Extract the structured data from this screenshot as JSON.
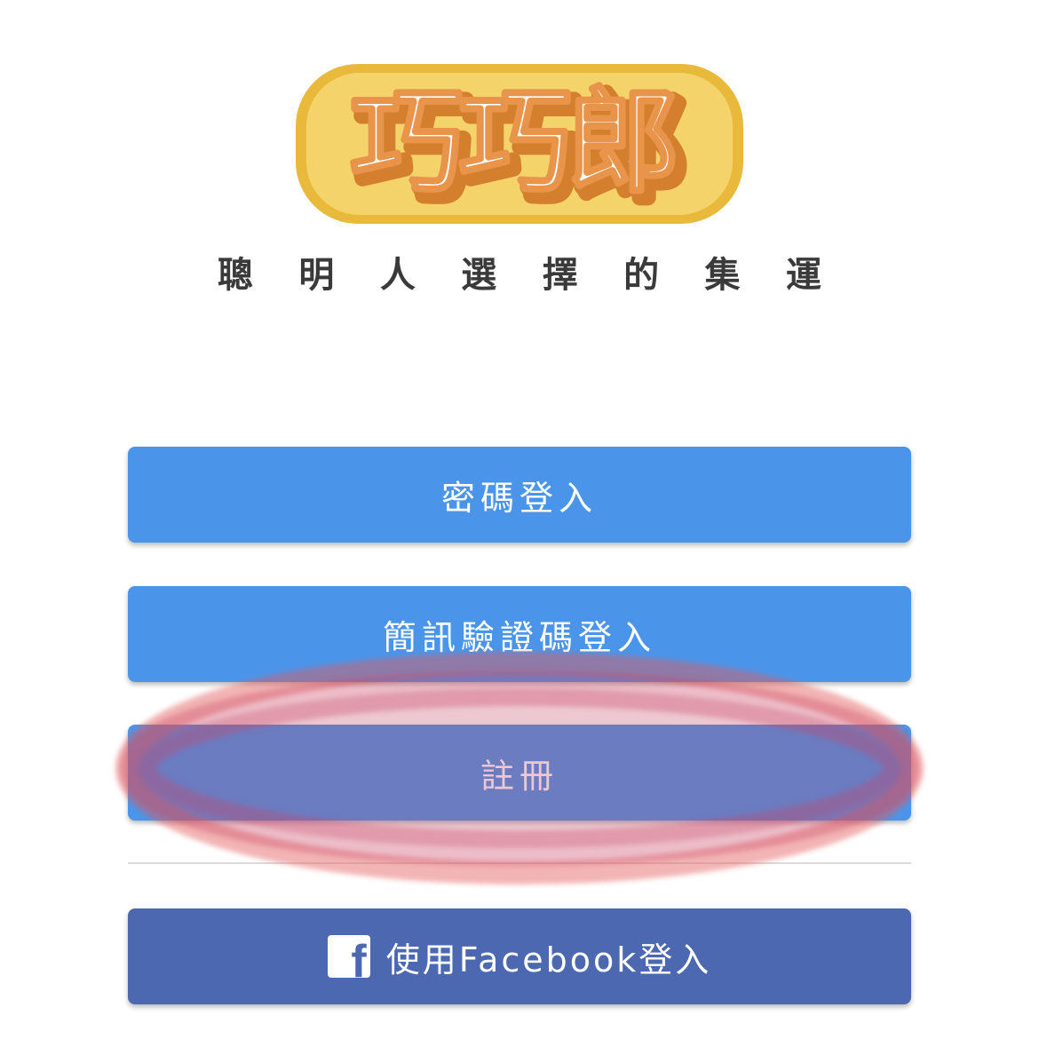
{
  "logo": {
    "text": "巧巧郎",
    "slogan": [
      "聰",
      "明",
      "人",
      "選",
      "擇",
      "的",
      "集",
      "運"
    ]
  },
  "buttons": {
    "password_login": "密碼登入",
    "sms_login": "簡訊驗證碼登入",
    "register": "註冊",
    "facebook_login": "使用Facebook登入"
  },
  "colors": {
    "primary_button": "#4a95ea",
    "facebook_button": "#4b68b1",
    "logo_outer": "#e8b93a",
    "logo_shadow": "#d47f2e",
    "highlight_ring": "#e35a5a"
  },
  "icons": {
    "facebook": "facebook-icon"
  }
}
